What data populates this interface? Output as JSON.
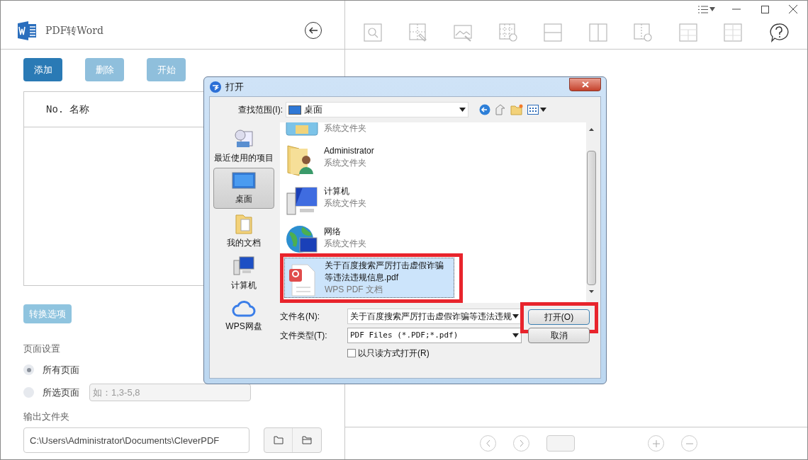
{
  "app": {
    "title": "PDF转Word"
  },
  "actions": [
    {
      "label": "添加",
      "disabled": false
    },
    {
      "label": "删除",
      "disabled": true
    },
    {
      "label": "开始",
      "disabled": true
    }
  ],
  "file_table": {
    "columns": [
      "No.",
      "名称"
    ]
  },
  "options_button": "转换选项",
  "page_settings": {
    "label": "页面设置",
    "range_placeholder": "如：1,3-5,8",
    "options": [
      {
        "label": "所有页面",
        "selected": true
      },
      {
        "label": "所选页面",
        "selected": false
      }
    ]
  },
  "output": {
    "label": "输出文件夹",
    "path": "C:\\Users\\Administrator\\Documents\\CleverPDF"
  },
  "dialog": {
    "title": "打开",
    "look_in_label": "查找范围(I):",
    "look_in_value": "桌面",
    "places": [
      {
        "kind": "recent",
        "label": "最近使用的项目",
        "selected": false
      },
      {
        "kind": "desktop",
        "label": "桌面",
        "selected": true
      },
      {
        "kind": "documents",
        "label": "我的文档",
        "selected": false
      },
      {
        "kind": "computer",
        "label": "计算机",
        "selected": false
      },
      {
        "kind": "cloud",
        "label": "WPS网盘",
        "selected": false
      }
    ],
    "files": [
      {
        "kind": "library",
        "type": "系统文件夹",
        "selected": false,
        "highlighted": false
      },
      {
        "kind": "user",
        "name": "Administrator",
        "type": "系统文件夹",
        "selected": false,
        "highlighted": false
      },
      {
        "kind": "computer",
        "name": "计算机",
        "type": "系统文件夹",
        "selected": false,
        "highlighted": false
      },
      {
        "kind": "network",
        "name": "网络",
        "type": "系统文件夹",
        "selected": false,
        "highlighted": false
      },
      {
        "kind": "pdf",
        "name": "关于百度搜索严厉打击虚假诈骗等违法违规信息.pdf",
        "type": "WPS PDF 文档",
        "selected": true,
        "highlighted": true
      }
    ],
    "filename_label": "文件名(N):",
    "filename_value": "关于百度搜索严厉打击虚假诈骗等违法违规",
    "filetype_label": "文件类型(T):",
    "filetype_value": "PDF Files (*.PDF;*.pdf)",
    "readonly": {
      "label": "以只读方式打开(R)",
      "checked": false
    },
    "buttons": [
      {
        "label": "打开(O)",
        "highlighted": true
      },
      {
        "label": "取消",
        "highlighted": false
      }
    ]
  }
}
